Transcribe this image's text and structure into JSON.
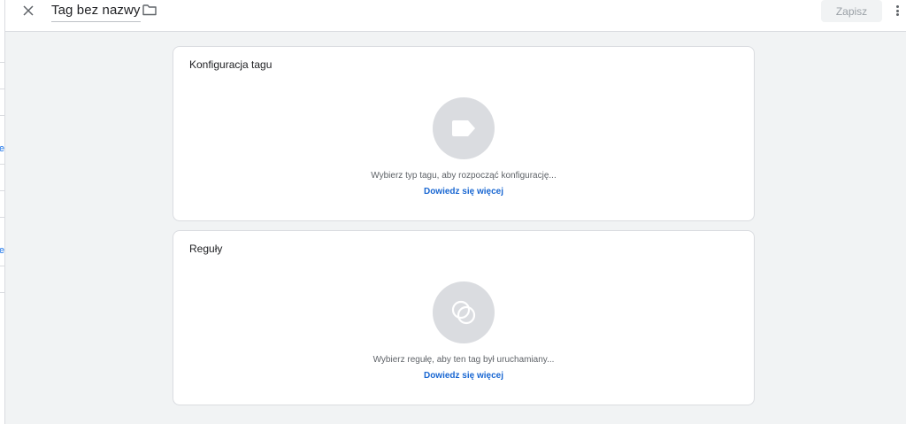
{
  "header": {
    "title": "Tag bez nazwy",
    "save_label": "Zapisz",
    "close_icon": "close-icon",
    "folder_icon": "folder-icon",
    "more_icon": "more-vert-icon"
  },
  "sidebar_fragments": [
    "e",
    "e"
  ],
  "sections": [
    {
      "title": "Konfiguracja tagu",
      "icon": "tag-icon",
      "hint": "Wybierz typ tagu, aby rozpocząć konfigurację...",
      "link": "Dowiedz się więcej"
    },
    {
      "title": "Reguły",
      "icon": "trigger-icon",
      "hint": "Wybierz regułę, aby ten tag był uruchamiany...",
      "link": "Dowiedz się więcej"
    }
  ],
  "colors": {
    "background": "#f1f3f4",
    "card": "#ffffff",
    "icon_circle": "#dadce0",
    "link": "#1967d2"
  }
}
